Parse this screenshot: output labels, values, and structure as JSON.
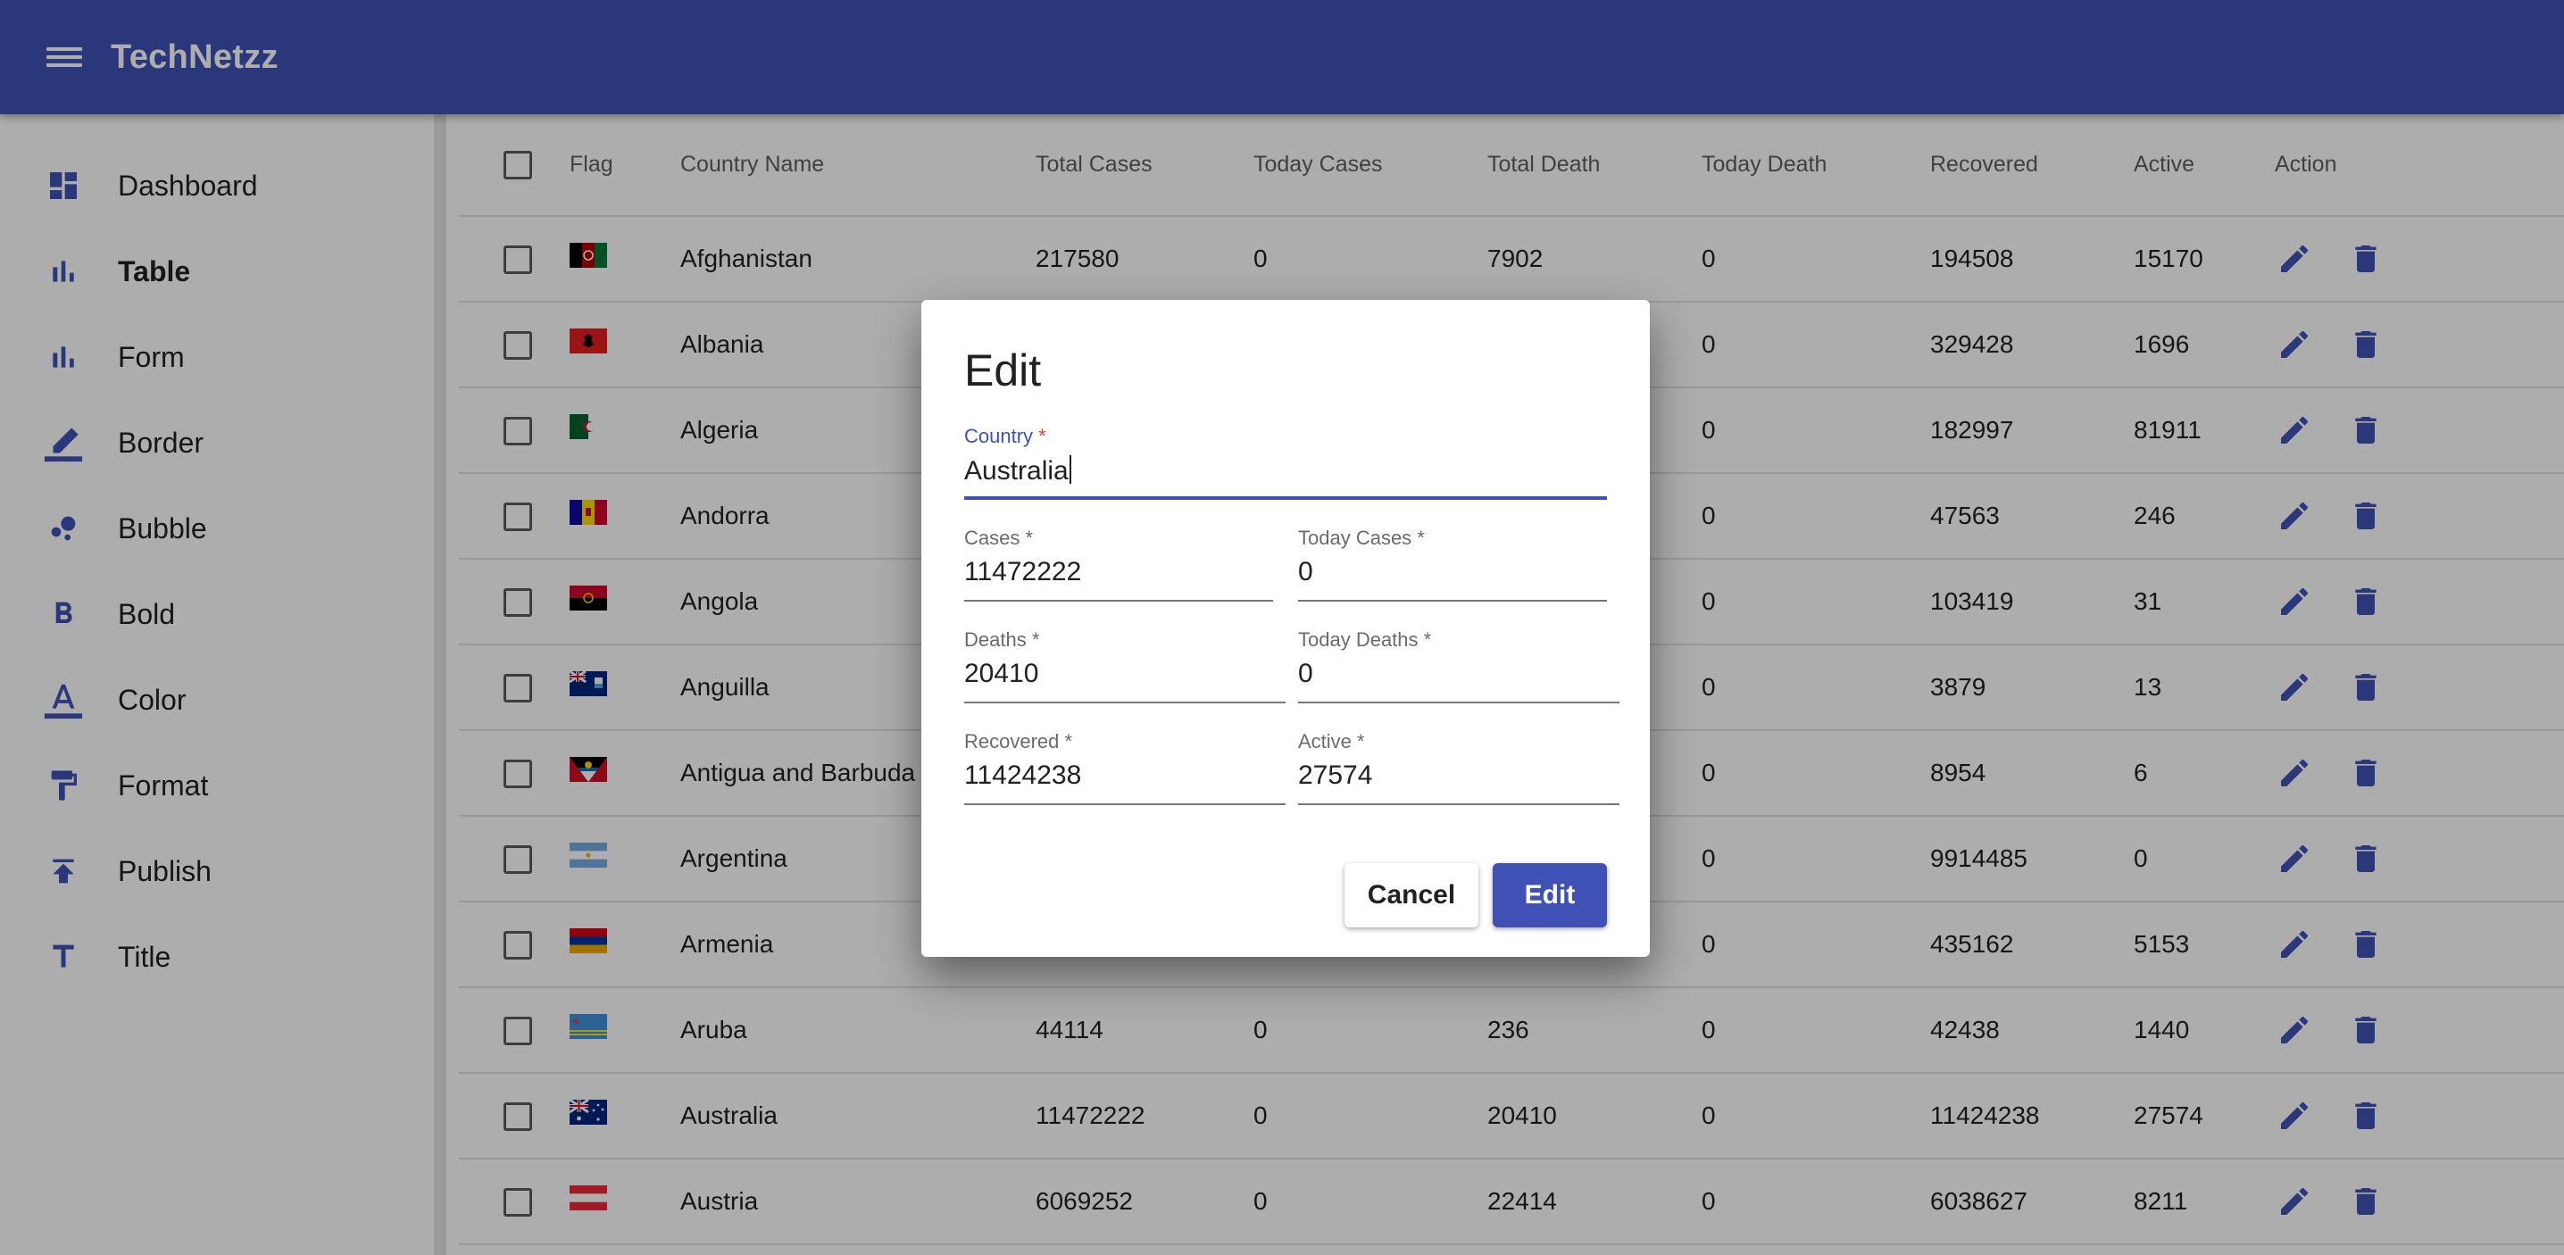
{
  "app": {
    "title": "TechNetzz"
  },
  "sidebar": {
    "items": [
      {
        "label": "Dashboard",
        "icon": "dashboard-icon"
      },
      {
        "label": "Table",
        "icon": "bar-chart-icon",
        "active": true
      },
      {
        "label": "Form",
        "icon": "bar-chart-icon"
      },
      {
        "label": "Border",
        "icon": "border-color-icon"
      },
      {
        "label": "Bubble",
        "icon": "bubble-chart-icon"
      },
      {
        "label": "Bold",
        "icon": "format-bold-icon"
      },
      {
        "label": "Color",
        "icon": "text-color-icon"
      },
      {
        "label": "Format",
        "icon": "paint-roller-icon"
      },
      {
        "label": "Publish",
        "icon": "publish-icon"
      },
      {
        "label": "Title",
        "icon": "title-icon"
      }
    ]
  },
  "table": {
    "headers": [
      "Flag",
      "Country Name",
      "Total Cases",
      "Today Cases",
      "Total Death",
      "Today Death",
      "Recovered",
      "Active",
      "Action"
    ],
    "rows": [
      {
        "flag": "afghanistan",
        "country": "Afghanistan",
        "cases": "217580",
        "today_cases": "0",
        "deaths": "7902",
        "today_deaths": "0",
        "recovered": "194508",
        "active": "15170"
      },
      {
        "flag": "albania",
        "country": "Albania",
        "cases": "",
        "today_cases": "",
        "deaths": "",
        "today_deaths": "0",
        "recovered": "329428",
        "active": "1696"
      },
      {
        "flag": "algeria",
        "country": "Algeria",
        "cases": "",
        "today_cases": "",
        "deaths": "",
        "today_deaths": "0",
        "recovered": "182997",
        "active": "81911"
      },
      {
        "flag": "andorra",
        "country": "Andorra",
        "cases": "",
        "today_cases": "",
        "deaths": "",
        "today_deaths": "0",
        "recovered": "47563",
        "active": "246"
      },
      {
        "flag": "angola",
        "country": "Angola",
        "cases": "",
        "today_cases": "",
        "deaths": "",
        "today_deaths": "0",
        "recovered": "103419",
        "active": "31"
      },
      {
        "flag": "anguilla",
        "country": "Anguilla",
        "cases": "",
        "today_cases": "",
        "deaths": "",
        "today_deaths": "0",
        "recovered": "3879",
        "active": "13"
      },
      {
        "flag": "antigua",
        "country": "Antigua and Barbuda",
        "cases": "",
        "today_cases": "",
        "deaths": "",
        "today_deaths": "0",
        "recovered": "8954",
        "active": "6"
      },
      {
        "flag": "argentina",
        "country": "Argentina",
        "cases": "",
        "today_cases": "",
        "deaths": "",
        "today_deaths": "0",
        "recovered": "9914485",
        "active": "0"
      },
      {
        "flag": "armenia",
        "country": "Armenia",
        "cases": "",
        "today_cases": "",
        "deaths": "",
        "today_deaths": "0",
        "recovered": "435162",
        "active": "5153"
      },
      {
        "flag": "aruba",
        "country": "Aruba",
        "cases": "44114",
        "today_cases": "0",
        "deaths": "236",
        "today_deaths": "0",
        "recovered": "42438",
        "active": "1440"
      },
      {
        "flag": "australia",
        "country": "Australia",
        "cases": "11472222",
        "today_cases": "0",
        "deaths": "20410",
        "today_deaths": "0",
        "recovered": "11424238",
        "active": "27574"
      },
      {
        "flag": "austria",
        "country": "Austria",
        "cases": "6069252",
        "today_cases": "0",
        "deaths": "22414",
        "today_deaths": "0",
        "recovered": "6038627",
        "active": "8211"
      }
    ]
  },
  "dialog": {
    "title": "Edit",
    "country": {
      "label": "Country",
      "value": "Australia"
    },
    "cases": {
      "label": "Cases",
      "value": "11472222"
    },
    "today_cases": {
      "label": "Today Cases",
      "value": "0"
    },
    "deaths": {
      "label": "Deaths",
      "value": "20410"
    },
    "today_deaths": {
      "label": "Today Deaths",
      "value": "0"
    },
    "recovered": {
      "label": "Recovered",
      "value": "11424238"
    },
    "active": {
      "label": "Active",
      "value": "27574"
    },
    "required_mark": "*",
    "cancel_label": "Cancel",
    "edit_label": "Edit"
  },
  "colors": {
    "primary": "#3f51b5",
    "required": "#e53935"
  }
}
